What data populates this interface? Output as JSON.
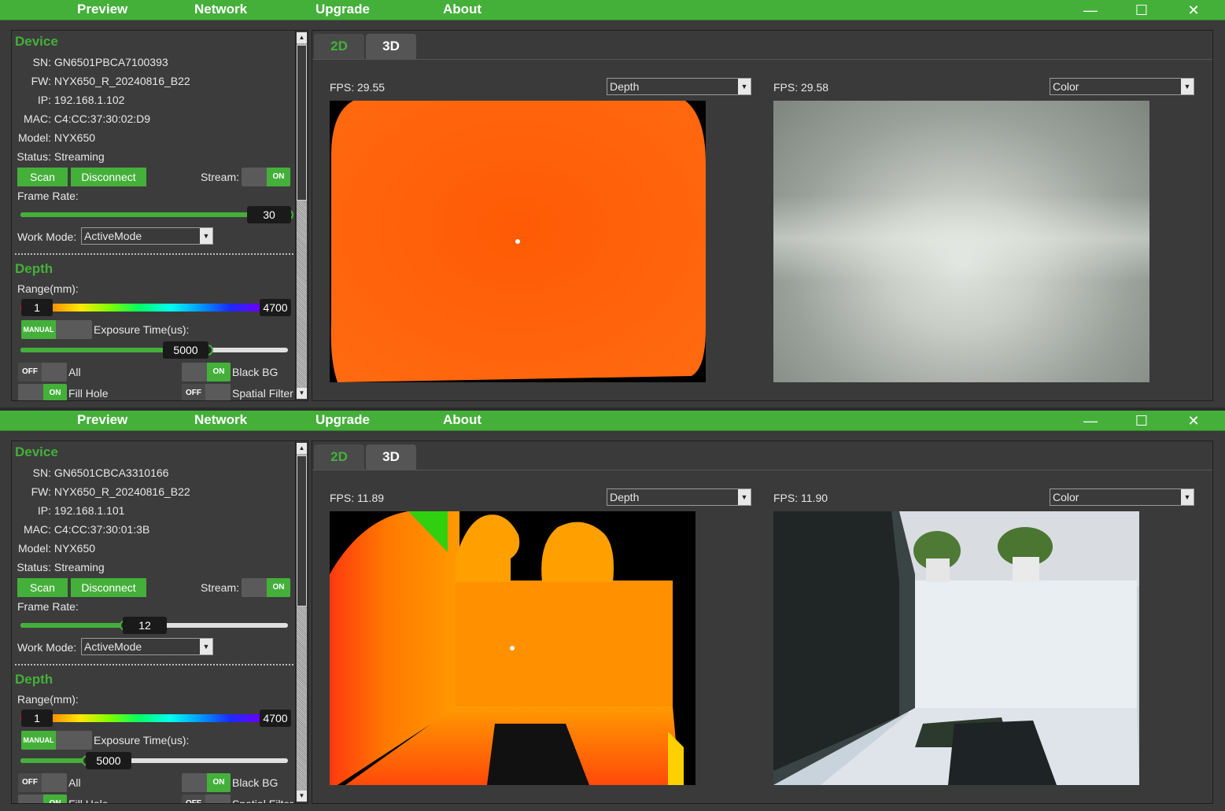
{
  "menu": [
    "Preview",
    "Network",
    "Upgrade",
    "About"
  ],
  "window_controls": {
    "minimize": "—",
    "maximize": "☐",
    "close": "✕"
  },
  "windows": [
    {
      "device": {
        "title": "Device",
        "sn_label": "SN:",
        "sn": "GN6501PBCA7100393",
        "fw_label": "FW:",
        "fw": "NYX650_R_20240816_B22",
        "ip_label": "IP:",
        "ip": "192.168.1.102",
        "mac_label": "MAC:",
        "mac": "C4:CC:37:30:02:D9",
        "model_label": "Model:",
        "model": "NYX650",
        "status_label": "Status:",
        "status": "Streaming",
        "scan": "Scan",
        "disconnect": "Disconnect",
        "stream_label": "Stream:",
        "stream_toggle": "ON",
        "frame_rate_label": "Frame Rate:",
        "frame_rate": "30",
        "frame_rate_fraction": 1.0,
        "work_mode_label": "Work Mode:",
        "work_mode": "ActiveMode"
      },
      "depth": {
        "title": "Depth",
        "range_label": "Range(mm):",
        "range_min": "1",
        "range_max": "4700",
        "exposure_toggle": "MANUAL",
        "exposure_label": "Exposure Time(us):",
        "exposure": "5000",
        "exposure_fraction": 0.7,
        "all_toggle": "OFF",
        "all_label": "All",
        "black_bg_toggle": "ON",
        "black_bg_label": "Black BG",
        "fill_hole_toggle": "ON",
        "fill_hole_label": "Fill Hole",
        "spatial_toggle": "OFF",
        "spatial_label": "Spatial Filter"
      },
      "tabs": [
        "2D",
        "3D"
      ],
      "left_view": {
        "fps_label": "FPS:",
        "fps": "29.55",
        "mode": "Depth"
      },
      "right_view": {
        "fps_label": "FPS:",
        "fps": "29.58",
        "mode": "Color"
      }
    },
    {
      "device": {
        "title": "Device",
        "sn_label": "SN:",
        "sn": "GN6501CBCA3310166",
        "fw_label": "FW:",
        "fw": "NYX650_R_20240816_B22",
        "ip_label": "IP:",
        "ip": "192.168.1.101",
        "mac_label": "MAC:",
        "mac": "C4:CC:37:30:01:3B",
        "model_label": "Model:",
        "model": "NYX650",
        "status_label": "Status:",
        "status": "Streaming",
        "scan": "Scan",
        "disconnect": "Disconnect",
        "stream_label": "Stream:",
        "stream_toggle": "ON",
        "frame_rate_label": "Frame Rate:",
        "frame_rate": "12",
        "frame_rate_fraction": 0.39,
        "work_mode_label": "Work Mode:",
        "work_mode": "ActiveMode"
      },
      "depth": {
        "title": "Depth",
        "range_label": "Range(mm):",
        "range_min": "1",
        "range_max": "4700",
        "exposure_toggle": "MANUAL",
        "exposure_label": "Exposure Time(us):",
        "exposure": "5000",
        "exposure_fraction": 0.25,
        "all_toggle": "OFF",
        "all_label": "All",
        "black_bg_toggle": "ON",
        "black_bg_label": "Black BG",
        "fill_hole_toggle": "ON",
        "fill_hole_label": "Fill Hole",
        "spatial_toggle": "OFF",
        "spatial_label": "Spatial Filter"
      },
      "tabs": [
        "2D",
        "3D"
      ],
      "left_view": {
        "fps_label": "FPS:",
        "fps": "11.89",
        "mode": "Depth"
      },
      "right_view": {
        "fps_label": "FPS:",
        "fps": "11.90",
        "mode": "Color"
      }
    }
  ],
  "colors": {
    "accent": "#44b03a",
    "panel": "#3a3a3a",
    "text": "#e6e6e6"
  }
}
